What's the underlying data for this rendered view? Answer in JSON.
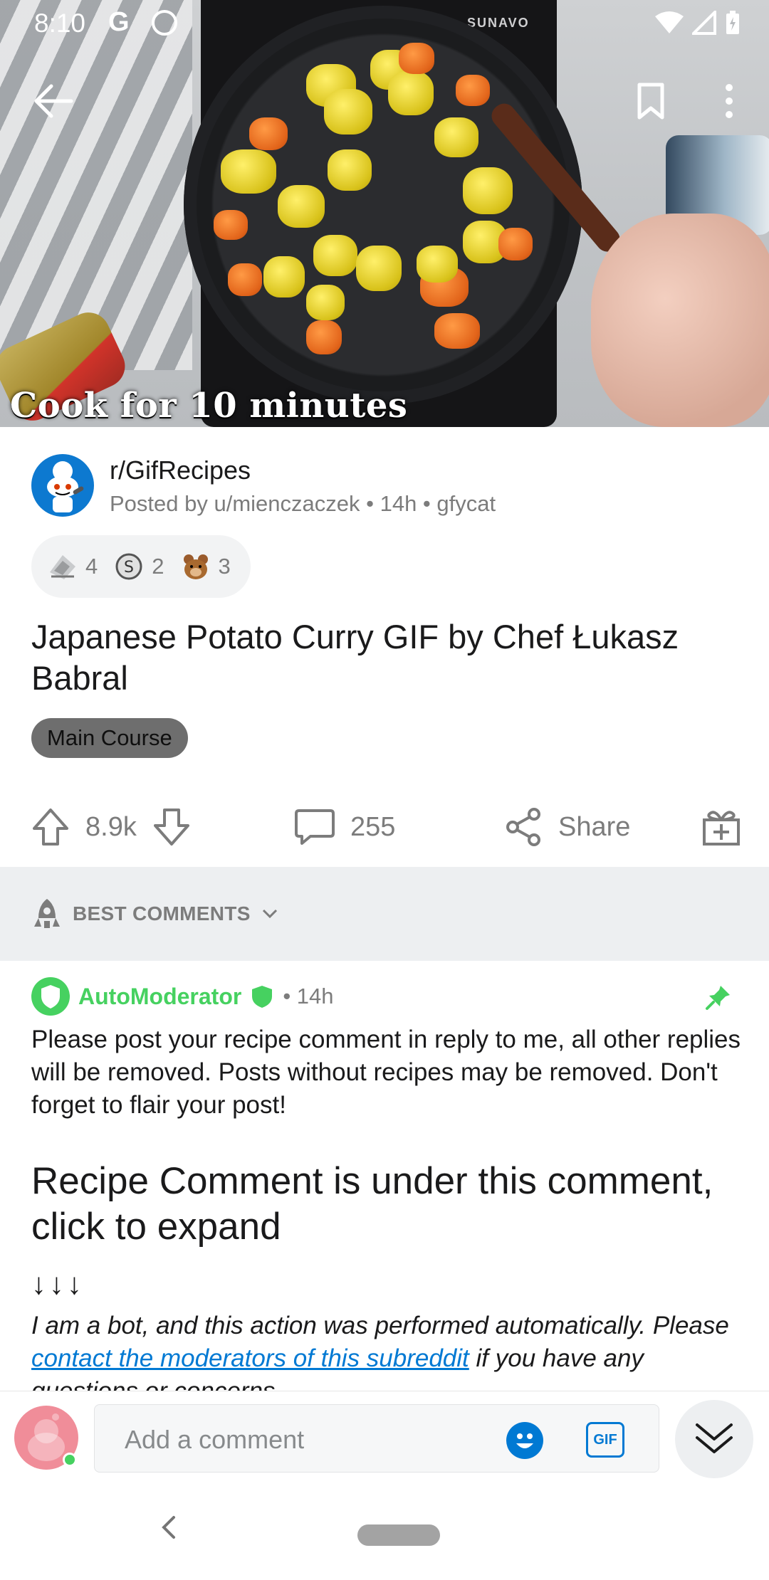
{
  "status_bar": {
    "time": "8:10",
    "g_icon": "G"
  },
  "media": {
    "brand": "SUNAVO",
    "caption": "Cook for 10 minutes"
  },
  "post": {
    "subreddit": "r/GifRecipes",
    "posted_by": "Posted by u/mienczaczek • 14h • gfycat",
    "awards": [
      {
        "icon": "award-silver-icon",
        "count": "4"
      },
      {
        "icon": "award-coin-icon",
        "count": "2"
      },
      {
        "icon": "award-bear-icon",
        "count": "3"
      }
    ],
    "title": "Japanese Potato Curry GIF by Chef Łukasz Babral",
    "flair": "Main Course",
    "votes": "8.9k",
    "comments": "255",
    "share_label": "Share"
  },
  "sort": {
    "label": "BEST COMMENTS"
  },
  "comment": {
    "author": "AutoModerator",
    "time": "• 14h",
    "body": "Please post your recipe comment in reply to me, all other replies will be removed. Posts without recipes may be removed. Don't forget to flair your post!",
    "heading": "Recipe Comment is under this comment, click to expand",
    "arrows": "↓↓↓",
    "bot_note_prefix": "I am a bot, and this action was performed automatically. Please ",
    "bot_note_link": "contact the moderators of this subreddit",
    "bot_note_suffix": " if you have any questions or concerns."
  },
  "composer": {
    "placeholder": "Add a comment",
    "gif_label": "GIF"
  },
  "colors": {
    "accent_green": "#46d160",
    "link_blue": "#0079d3",
    "meta_gray": "#7c7c7c"
  }
}
